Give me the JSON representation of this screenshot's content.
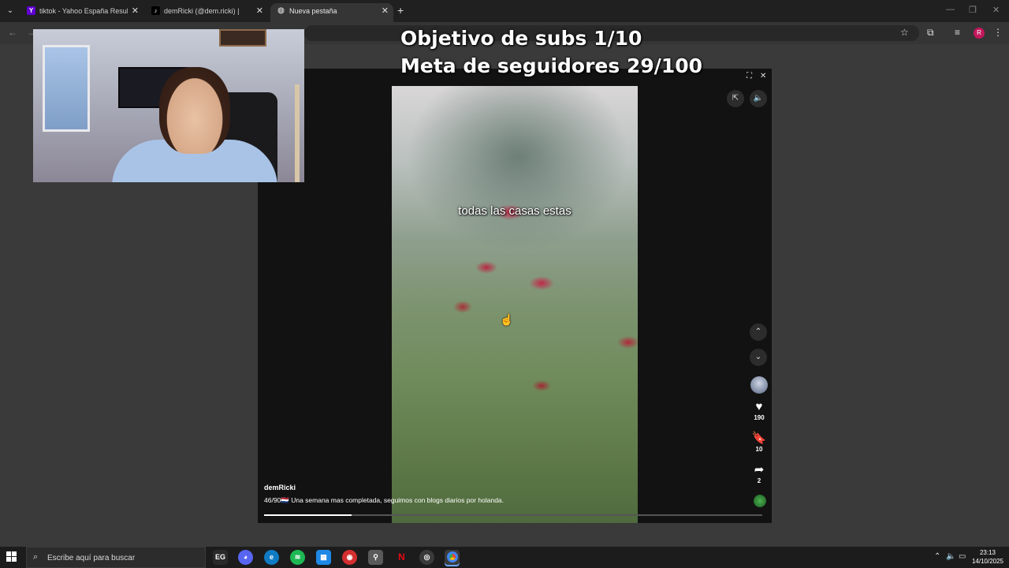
{
  "browser": {
    "tabs": [
      {
        "title": "tiktok - Yahoo España Resultad",
        "favicon": "yahoo-icon",
        "active": false
      },
      {
        "title": "demRicki (@dem.ricki) | Tik",
        "favicon": "tiktok-icon",
        "active": false
      },
      {
        "title": "Nueva pestaña",
        "favicon": "globe-icon",
        "active": true
      }
    ],
    "new_tab": "+",
    "profile_initial": "R"
  },
  "overlay": {
    "line1": "Objetivo de subs 1/10",
    "line2": "Meta de seguidores 29/100"
  },
  "video": {
    "caption": "todas las casas estas",
    "author": "demRicki",
    "description": "46/90🇳🇱 Una semana mas completada, seguimos con blogs diarios por holanda.",
    "progress": 0.175
  },
  "actions": {
    "likes": "190",
    "saves": "10",
    "shares": "2"
  },
  "taskbar": {
    "search_placeholder": "Escribe aquí para buscar",
    "time": "23:13",
    "date": "14/10/2025"
  },
  "colors": {
    "modal_bg": "#121212",
    "taskbar_bg": "#1c1c1c",
    "profile": "#c2185b"
  }
}
